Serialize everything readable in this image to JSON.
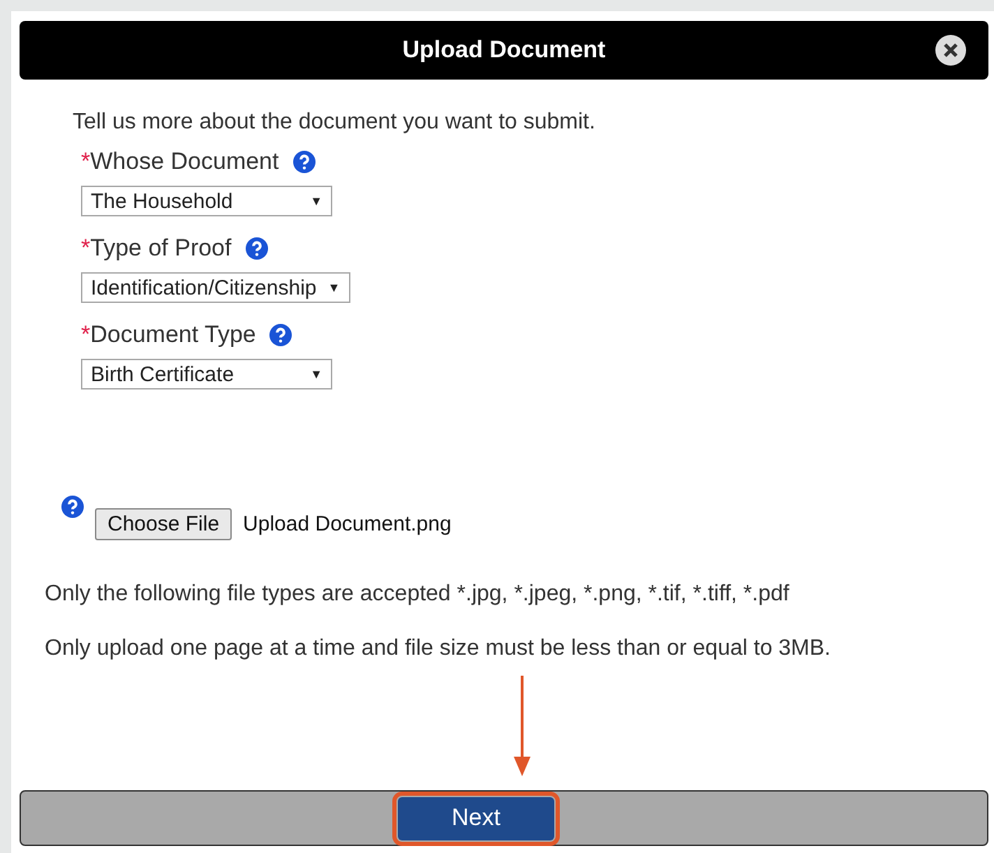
{
  "dialog": {
    "title": "Upload Document",
    "intro": "Tell us more about the document you want to submit.",
    "fields": [
      {
        "required_mark": "*",
        "label": "Whose Document",
        "value": "The Household",
        "arrow": "▼"
      },
      {
        "required_mark": "*",
        "label": "Type of Proof",
        "value": "Identification/Citizenship",
        "arrow": "▼"
      },
      {
        "required_mark": "*",
        "label": "Document Type",
        "value": "Birth Certificate",
        "arrow": "▼"
      }
    ],
    "file": {
      "button": "Choose File",
      "filename": "Upload Document.png"
    },
    "notes": [
      "Only the following file types are accepted *.jpg, *.jpeg, *.png, *.tif, *.tiff, *.pdf",
      "Only upload one page at a time and file size must be less than or equal to 3MB."
    ],
    "next_button": {
      "label": "Next",
      "highlighted": true
    }
  }
}
